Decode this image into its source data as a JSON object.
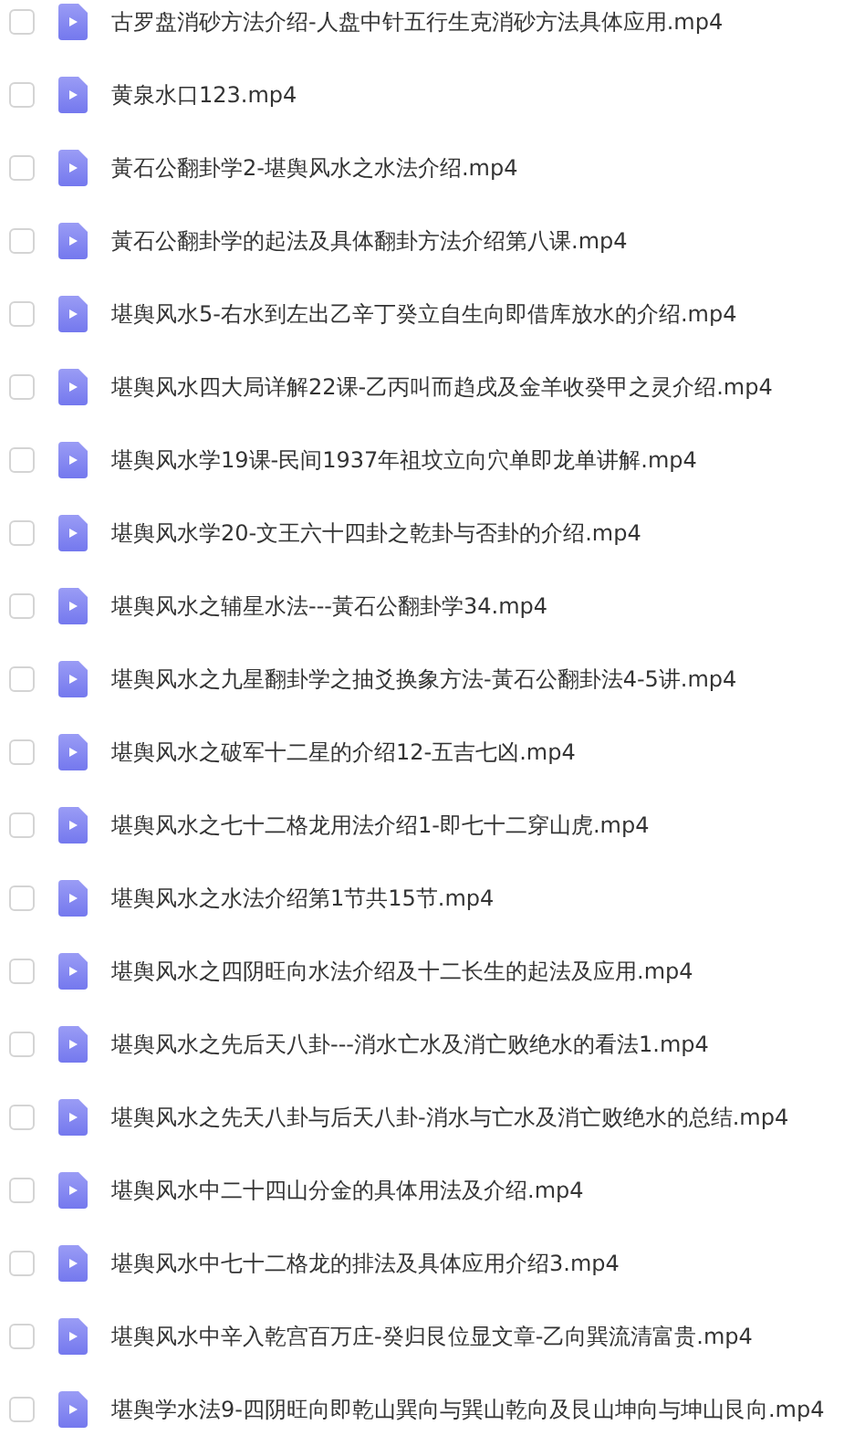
{
  "files": [
    {
      "name": "古罗盘消砂方法介绍-人盘中针五行生克消砂方法具体应用.mp4",
      "checked": false
    },
    {
      "name": "黄泉水口123.mp4",
      "checked": false
    },
    {
      "name": "黃石公翻卦学2-堪舆风水之水法介绍.mp4",
      "checked": false
    },
    {
      "name": "黃石公翻卦学的起法及具体翻卦方法介绍第八课.mp4",
      "checked": false
    },
    {
      "name": "堪舆风水5-右水到左出乙辛丁癸立自生向即借库放水的介绍.mp4",
      "checked": false
    },
    {
      "name": "堪舆风水四大局详解22课-乙丙叫而趋戌及金羊收癸甲之灵介绍.mp4",
      "checked": false
    },
    {
      "name": "堪舆风水学19课-民间1937年祖坟立向穴单即龙单讲解.mp4",
      "checked": false
    },
    {
      "name": "堪舆风水学20-文王六十四卦之乾卦与否卦的介绍.mp4",
      "checked": false
    },
    {
      "name": "堪舆风水之辅星水法---黃石公翻卦学34.mp4",
      "checked": false
    },
    {
      "name": "堪舆风水之九星翻卦学之抽爻换象方法-黃石公翻卦法4-5讲.mp4",
      "checked": false
    },
    {
      "name": "堪舆风水之破军十二星的介绍12-五吉七凶.mp4",
      "checked": false
    },
    {
      "name": "堪舆风水之七十二格龙用法介绍1-即七十二穿山虎.mp4",
      "checked": false
    },
    {
      "name": "堪舆风水之水法介绍第1节共15节.mp4",
      "checked": false
    },
    {
      "name": "堪舆风水之四阴旺向水法介绍及十二长生的起法及应用.mp4",
      "checked": false
    },
    {
      "name": "堪舆风水之先后天八卦---消水亡水及消亡败绝水的看法1.mp4",
      "checked": false
    },
    {
      "name": "堪舆风水之先天八卦与后天八卦-消水与亡水及消亡败绝水的总结.mp4",
      "checked": false
    },
    {
      "name": "堪舆风水中二十四山分金的具体用法及介绍.mp4",
      "checked": false
    },
    {
      "name": "堪舆风水中七十二格龙的排法及具体应用介绍3.mp4",
      "checked": false
    },
    {
      "name": "堪舆风水中辛入乾宫百万庄-癸归艮位显文章-乙向巽流清富贵.mp4",
      "checked": false
    },
    {
      "name": "堪舆学水法9-四阴旺向即乾山巽向与巽山乾向及艮山坤向与坤山艮向.mp4",
      "checked": false
    }
  ]
}
